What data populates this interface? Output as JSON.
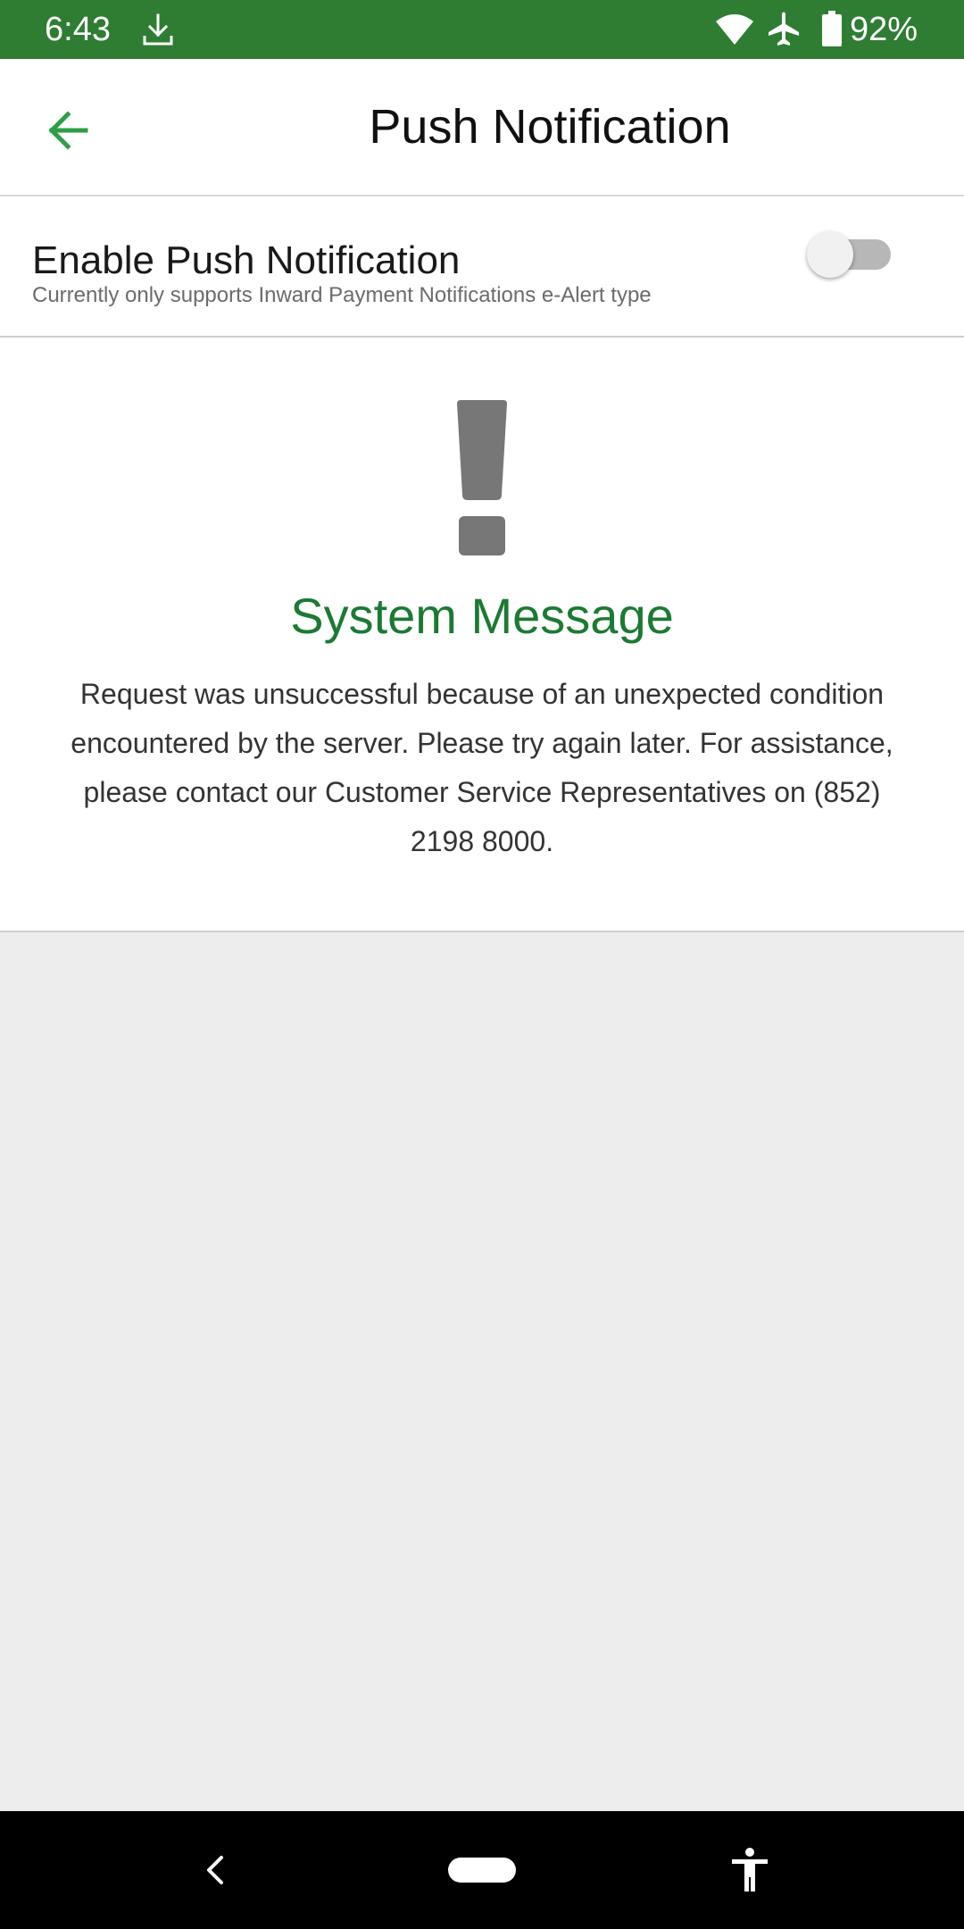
{
  "status_bar": {
    "time": "6:43",
    "battery_percent": "92%",
    "icons": [
      "download-icon",
      "wifi-icon",
      "airplane-mode-icon",
      "battery-icon"
    ],
    "background_color": "#2e7d32"
  },
  "app_bar": {
    "title": "Push Notification",
    "back_icon": "arrow-left-icon",
    "accent_color": "#2e9e45"
  },
  "settings": {
    "enable_push": {
      "label": "Enable Push Notification",
      "description": "Currently only supports Inward Payment Notifications e-Alert type",
      "enabled": false
    }
  },
  "system_message": {
    "icon": "exclamation-icon",
    "title": "System Message",
    "body": "Request was unsuccessful because of an unexpected condition encountered by the server. Please try again later. For assistance, please contact our Customer Service Representatives on (852) 2198 8000.",
    "title_color": "#1b7a33"
  },
  "nav_bar": {
    "icons": [
      "nav-back-icon",
      "nav-home-pill",
      "accessibility-icon"
    ]
  }
}
